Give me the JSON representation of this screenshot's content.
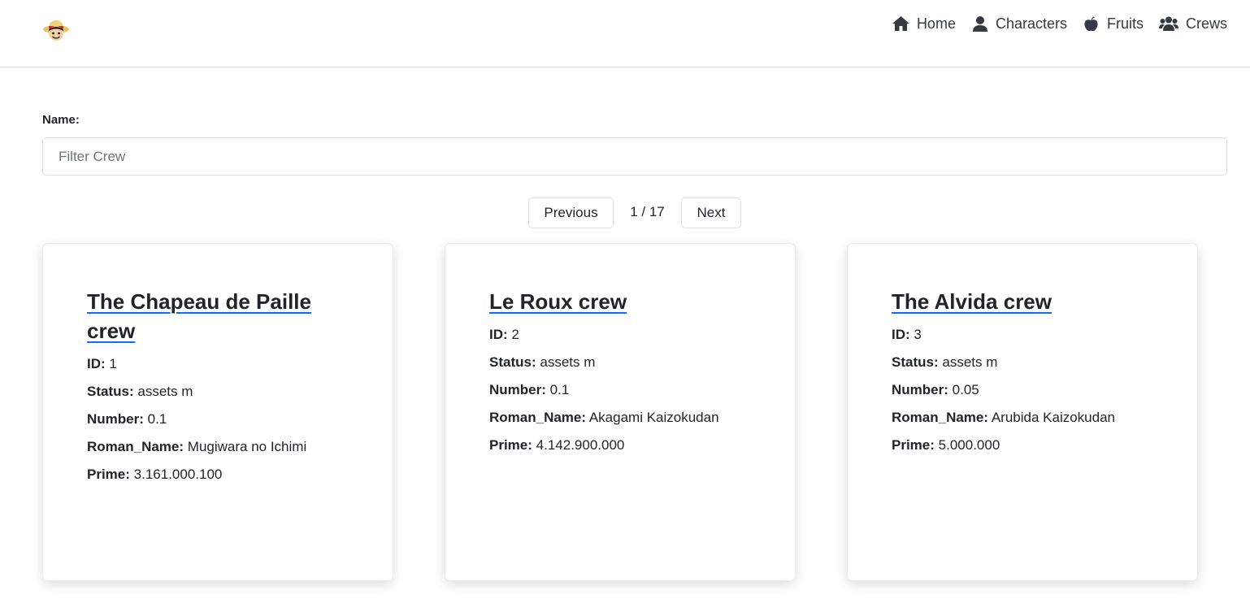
{
  "nav": {
    "logo_icon": "straw-hat-pirate-icon",
    "items": [
      {
        "label": "Home",
        "icon": "home-icon"
      },
      {
        "label": "Characters",
        "icon": "user-icon"
      },
      {
        "label": "Fruits",
        "icon": "apple-icon"
      },
      {
        "label": "Crews",
        "icon": "users-icon"
      }
    ]
  },
  "filter": {
    "label": "Name:",
    "placeholder": "Filter Crew",
    "value": ""
  },
  "pagination": {
    "previous_label": "Previous",
    "page_text": "1 / 17",
    "next_label": "Next"
  },
  "field_labels": {
    "id": "ID:",
    "status": "Status:",
    "number": "Number:",
    "roman_name": "Roman_Name:",
    "prime": "Prime:"
  },
  "crews": [
    {
      "name": "The Chapeau de Paille crew",
      "id": "1",
      "status": "assets m",
      "number": "0.1",
      "roman_name": "Mugiwara no Ichimi",
      "prime": "3.161.000.100"
    },
    {
      "name": "Le Roux crew",
      "id": "2",
      "status": "assets m",
      "number": "0.1",
      "roman_name": "Akagami Kaizokudan",
      "prime": "4.142.900.000"
    },
    {
      "name": "The Alvida crew",
      "id": "3",
      "status": "assets m",
      "number": "0.05",
      "roman_name": "Arubida Kaizokudan",
      "prime": "5.000.000"
    }
  ],
  "colors": {
    "accent_underline": "#0d6efd",
    "text": "#212529",
    "border": "#dee2e6"
  }
}
